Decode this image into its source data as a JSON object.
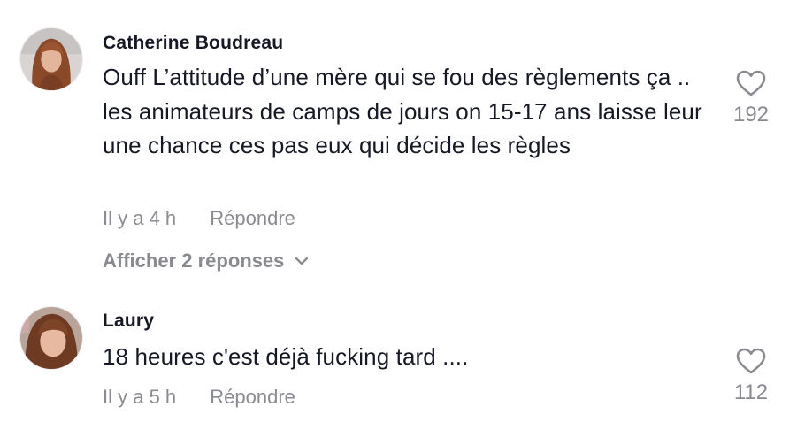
{
  "comments": [
    {
      "username": "Catherine Boudreau",
      "text": "Ouff L’attitude d’une mère qui se fou des règlements ça .. les animateurs de camps de jours on 15-17 ans laisse leur une chance ces pas eux qui décide les règles",
      "time": "Il y a 4 h",
      "reply_label": "Répondre",
      "view_replies": "Afficher 2 réponses",
      "likes": "192"
    },
    {
      "username": "Laury",
      "text": "18 heures c'est déjà fucking tard ....",
      "time": "Il y a 5 h",
      "reply_label": "Répondre",
      "likes": "112"
    }
  ],
  "icons": {
    "like": "heart-outline-icon",
    "expand": "chevron-down-icon"
  },
  "colors": {
    "primary_text": "#161823",
    "secondary_text": "#8a8b91",
    "background": "#ffffff"
  }
}
